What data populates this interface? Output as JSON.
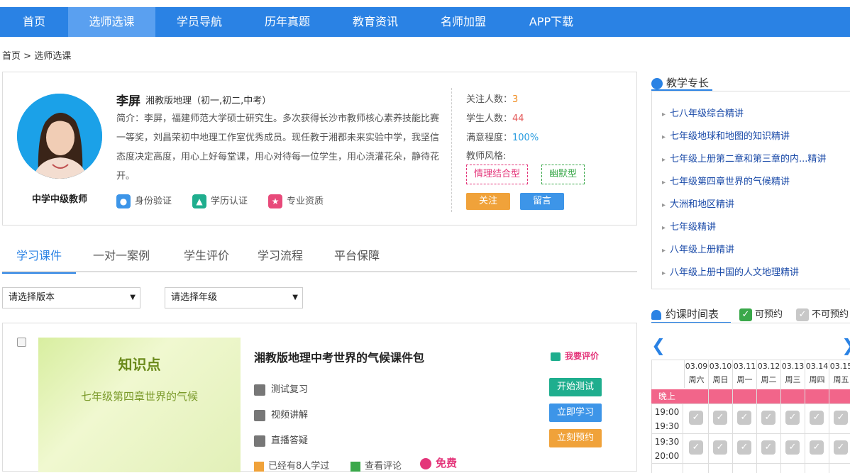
{
  "nav": {
    "items": [
      "首页",
      "选师选课",
      "学员导航",
      "历年真题",
      "教育资讯",
      "名师加盟",
      "APP下载"
    ],
    "active_index": 1
  },
  "breadcrumb": {
    "home": "首页",
    "sep": ">",
    "current": "选师选课"
  },
  "teacher": {
    "name": "李屏",
    "subject": "湘教版地理（初一,初二,中考）",
    "level": "中学中级教师",
    "intro": "简介：李屏，福建师范大学硕士研究生。多次获得长沙市教师核心素养技能比赛一等奖，刘昌荣初中地理工作室优秀成员。现任教于湘郡未来实验中学，我坚信态度决定高度，用心上好每堂课，用心对待每一位学生，用心浇灌花朵，静待花开。",
    "certs": [
      "身份验证",
      "学历认证",
      "专业资质"
    ],
    "stats": {
      "followers_label": "关注人数：",
      "followers": "3",
      "students_label": "学生人数：",
      "students": "44",
      "satisfaction_label": "满意程度：",
      "satisfaction": "100%",
      "style_label": "教师风格:"
    },
    "styles": [
      "情理结合型",
      "幽默型"
    ],
    "follow_btn": "关注",
    "message_btn": "留言"
  },
  "tabs": [
    "学习课件",
    "一对一案例",
    "学生评价",
    "学习流程",
    "平台保障"
  ],
  "filters": {
    "version": "请选择版本",
    "grade": "请选择年级"
  },
  "course": {
    "thumb_title": "知识点",
    "thumb_sub": "七年级第四章世界的气候",
    "title": "湘教版地理中考世界的气候课件包",
    "rate": "我要评价",
    "rows": [
      {
        "label": "测试复习",
        "button": "开始测试",
        "color": "#1fae8e"
      },
      {
        "label": "视频讲解",
        "button": "立即学习",
        "color": "#3d95e8"
      },
      {
        "label": "直播答疑",
        "button": "立刻预约",
        "color": "#f0a23a"
      }
    ],
    "footer": {
      "learners": "已经有8人学过",
      "reviews": "查看评论",
      "price": "免费"
    }
  },
  "sidebar": {
    "skills_title": "教学专长",
    "skills": [
      "七八年级综合精讲",
      "七年级地球和地图的知识精讲",
      "七年级上册第二章和第三章的内...精讲",
      "七年级第四章世界的气候精讲",
      "大洲和地区精讲",
      "七年级精讲",
      "八年级上册精讲",
      "八年级上册中国的人文地理精讲"
    ],
    "schedule_title": "约课时间表",
    "available": "可预约",
    "unavailable": "不可预约",
    "dates": [
      "03.09",
      "03.10",
      "03.11",
      "03.12",
      "03.13",
      "03.14",
      "03.15"
    ],
    "weekdays": [
      "周六",
      "周日",
      "周一",
      "周二",
      "周三",
      "周四",
      "周五"
    ],
    "night": "晚上",
    "slots": [
      [
        "19:00",
        "19:30"
      ],
      [
        "19:30",
        "20:00"
      ]
    ]
  },
  "colors": {
    "nav": "#2a82e4",
    "accent": "#2a82e4",
    "night": "#f2658a"
  }
}
